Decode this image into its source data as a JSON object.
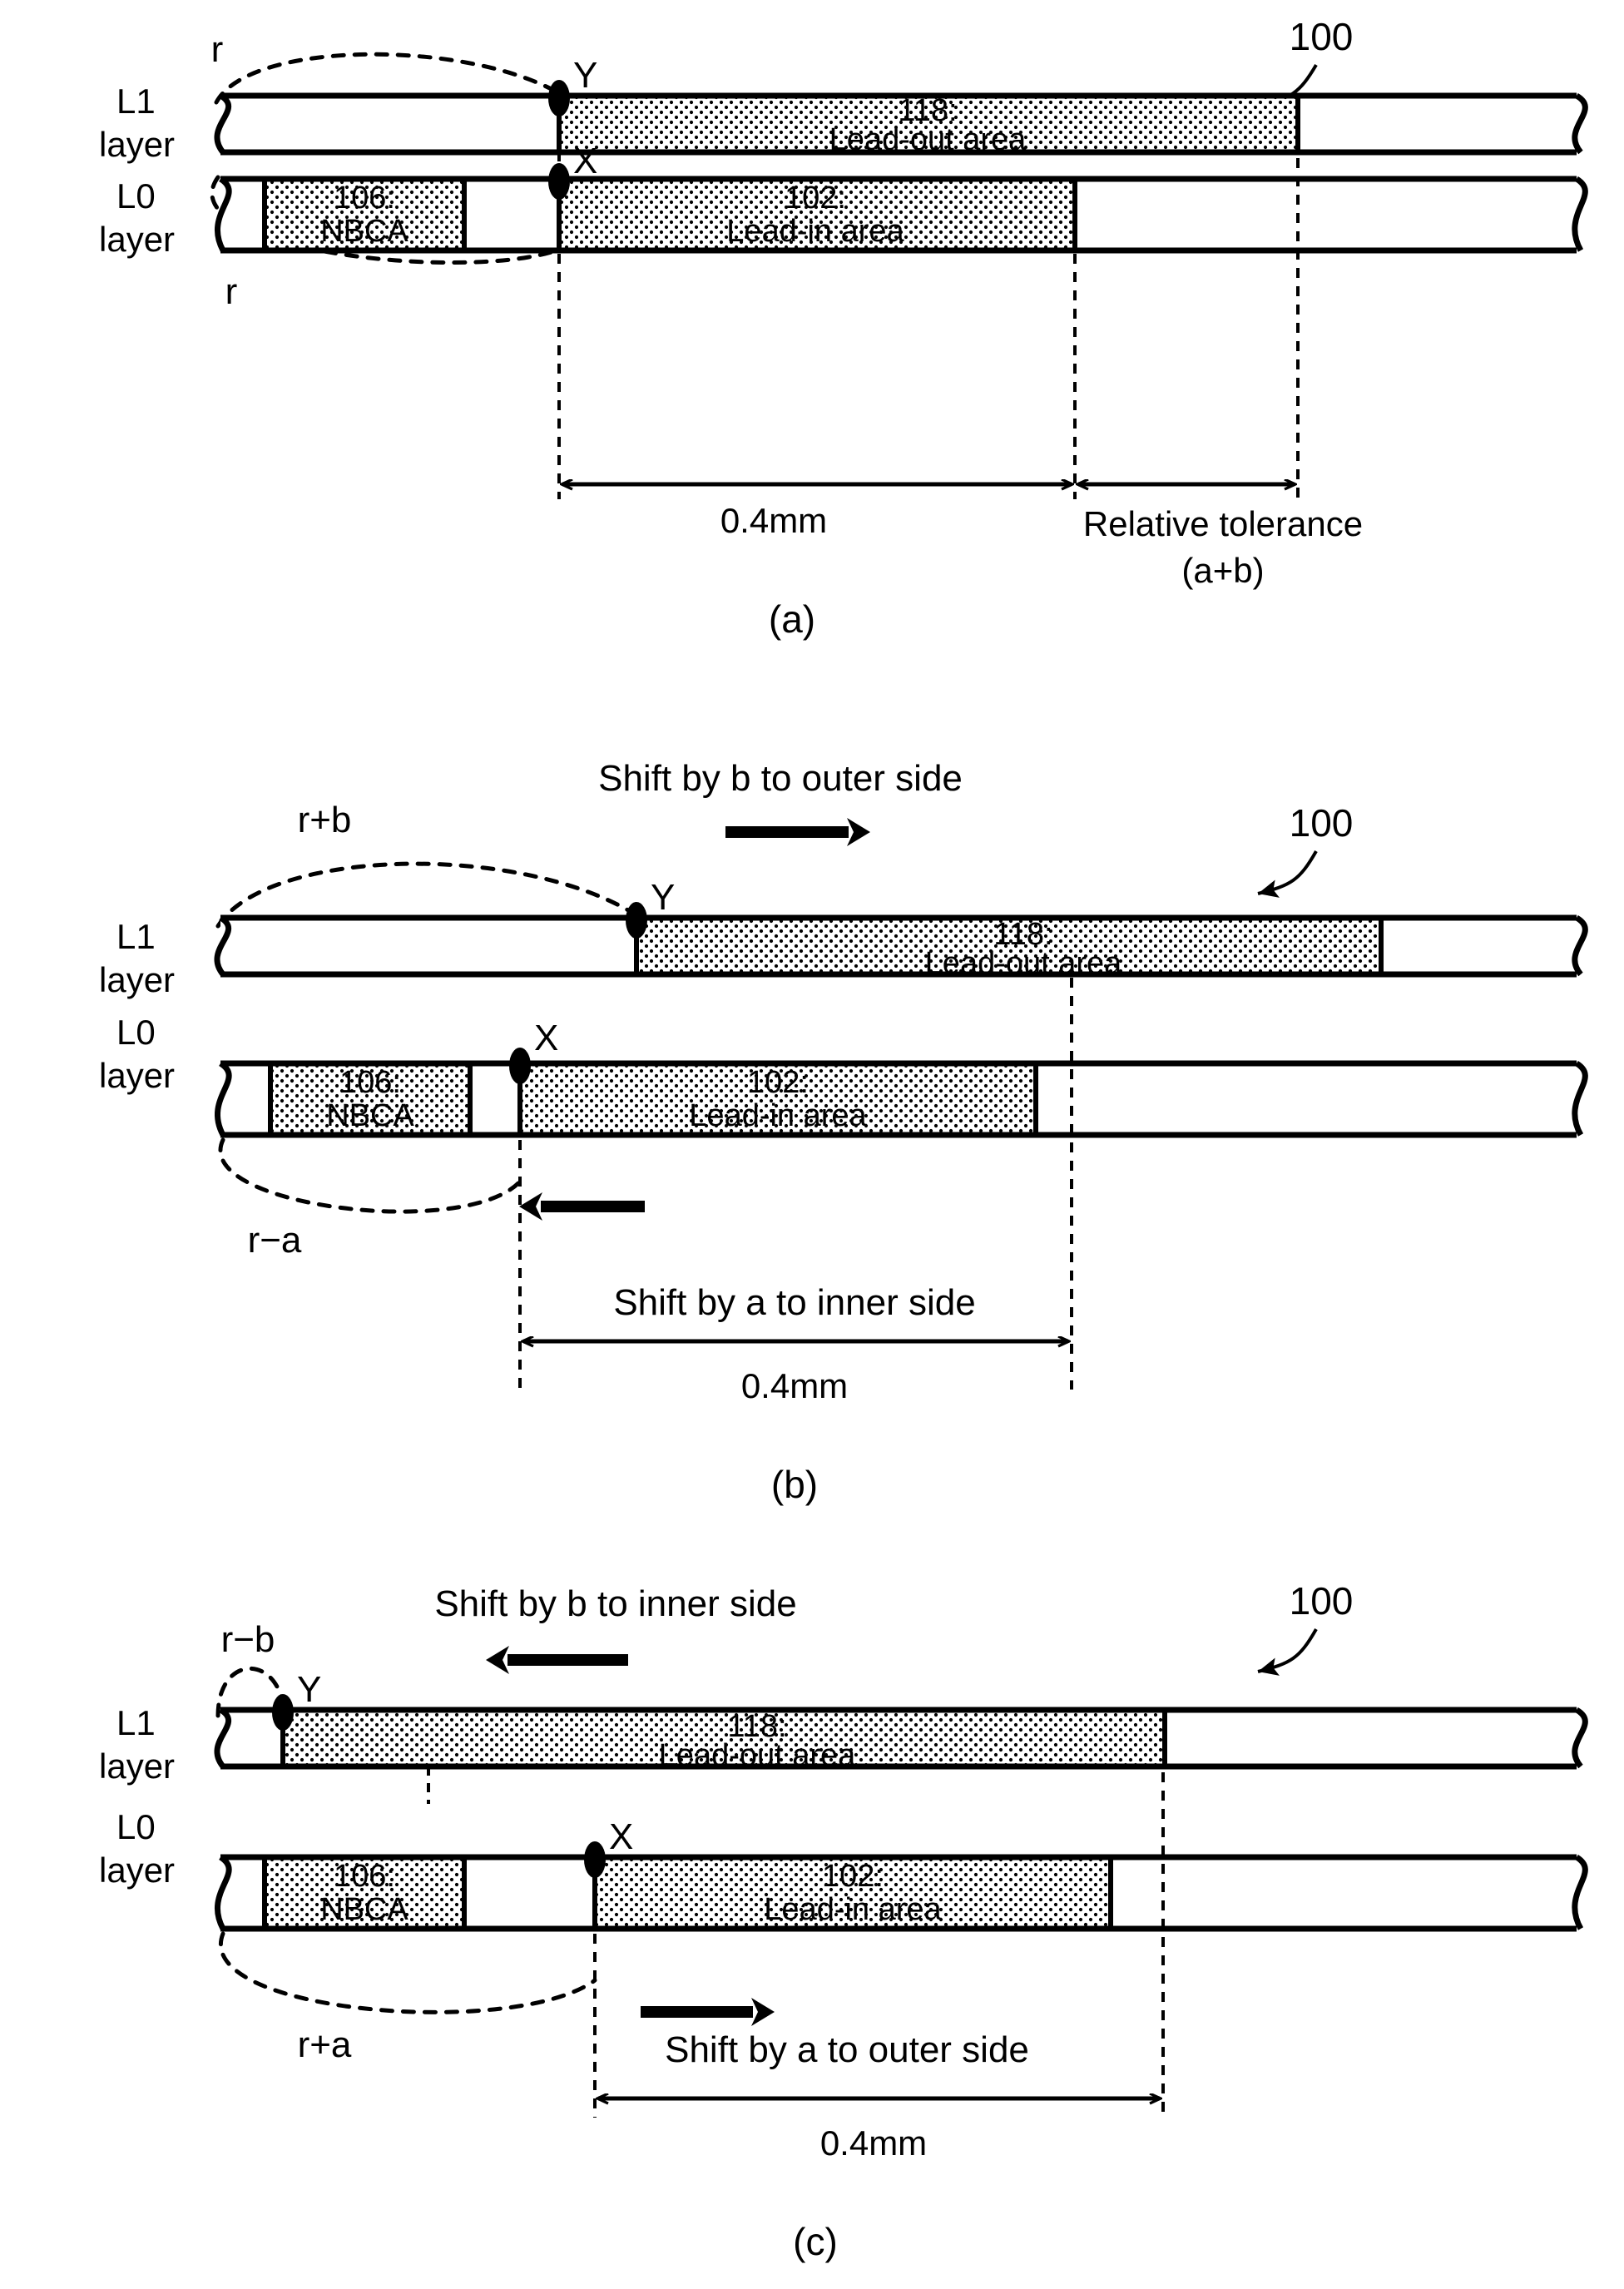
{
  "figure": {
    "reference_numeral": "100",
    "layer_labels": {
      "l1_line1": "L1",
      "l1_line2": "layer",
      "l0_line1": "L0",
      "l0_line2": "layer"
    },
    "point_labels": {
      "y": "Y",
      "x": "X"
    },
    "blocks": {
      "nbca_num": "106:",
      "nbca_name": "NBCA",
      "leadin_num": "102:",
      "leadin_name": "Lead-in area",
      "leadout_num": "118:",
      "leadout_name": "Lead-out area"
    },
    "dimensions": {
      "nominal": "0.4mm",
      "tolerance_line1": "Relative tolerance",
      "tolerance_line2": "(a+b)"
    }
  },
  "panels": [
    {
      "id": "a",
      "caption": "(a)",
      "arc_top_label": "r",
      "arc_bottom_label": "r",
      "reference_numeral": "100",
      "dimension_label": "0.4mm",
      "tolerance_label_line1": "Relative tolerance",
      "tolerance_label_line2": "(a+b)",
      "shift_notes": []
    },
    {
      "id": "b",
      "caption": "(b)",
      "arc_top_label": "r+b",
      "arc_bottom_label": "r−a",
      "reference_numeral": "100",
      "dimension_label": "0.4mm",
      "shift_notes": [
        {
          "text": "Shift by b to outer side",
          "direction": "right"
        },
        {
          "text": "Shift by a to inner side",
          "direction": "left"
        }
      ]
    },
    {
      "id": "c",
      "caption": "(c)",
      "arc_top_label": "r−b",
      "arc_bottom_label": "r+a",
      "reference_numeral": "100",
      "dimension_label": "0.4mm",
      "shift_notes": [
        {
          "text": "Shift by b to inner side",
          "direction": "left"
        },
        {
          "text": "Shift by a to outer side",
          "direction": "right"
        }
      ]
    }
  ],
  "colors": {
    "ink": "#000000",
    "paper": "#ffffff",
    "hatch_dot": "#000000"
  }
}
